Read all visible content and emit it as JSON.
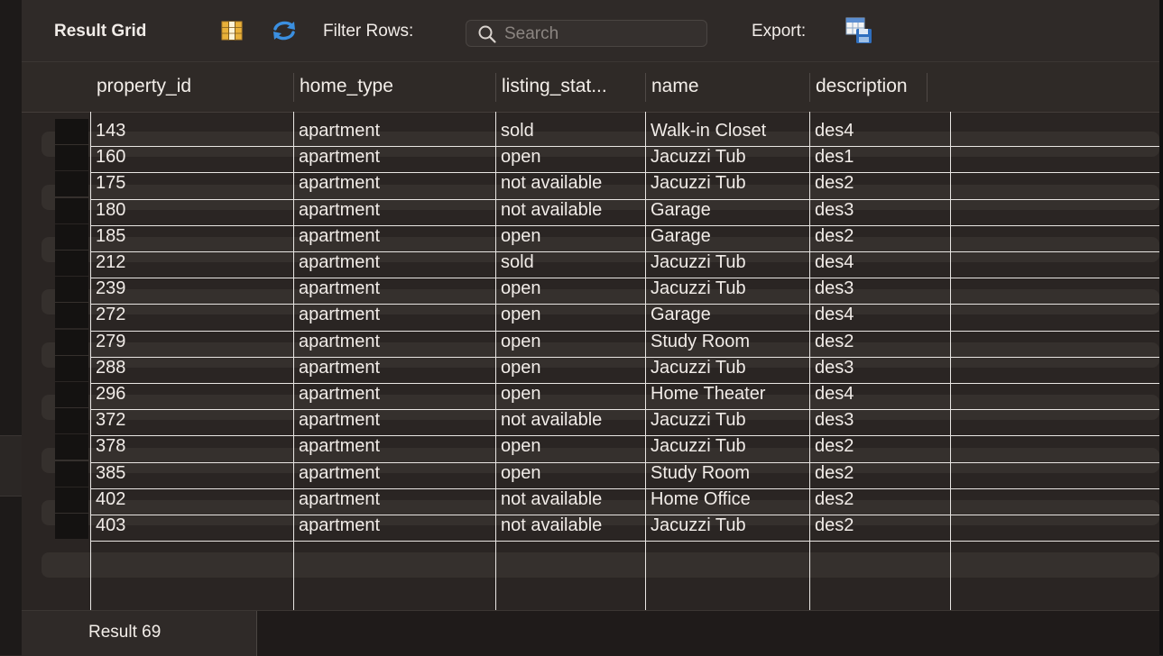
{
  "toolbar": {
    "result_grid_label": "Result Grid",
    "filter_rows_label": "Filter Rows:",
    "search_placeholder": "Search",
    "export_label": "Export:",
    "icons": [
      "grid-layout-icon",
      "refresh-icon",
      "search-icon",
      "export-icon"
    ]
  },
  "columns": [
    "property_id",
    "home_type",
    "listing_stat...",
    "name",
    "description"
  ],
  "rows": [
    [
      "143",
      "apartment",
      "sold",
      "Walk-in Closet",
      "des4"
    ],
    [
      "160",
      "apartment",
      "open",
      "Jacuzzi Tub",
      "des1"
    ],
    [
      "175",
      "apartment",
      "not available",
      "Jacuzzi Tub",
      "des2"
    ],
    [
      "180",
      "apartment",
      "not available",
      "Garage",
      "des3"
    ],
    [
      "185",
      "apartment",
      "open",
      "Garage",
      "des2"
    ],
    [
      "212",
      "apartment",
      "sold",
      "Jacuzzi Tub",
      "des4"
    ],
    [
      "239",
      "apartment",
      "open",
      "Jacuzzi Tub",
      "des3"
    ],
    [
      "272",
      "apartment",
      "open",
      "Garage",
      "des4"
    ],
    [
      "279",
      "apartment",
      "open",
      "Study Room",
      "des2"
    ],
    [
      "288",
      "apartment",
      "open",
      "Jacuzzi Tub",
      "des3"
    ],
    [
      "296",
      "apartment",
      "open",
      "Home Theater",
      "des4"
    ],
    [
      "372",
      "apartment",
      "not available",
      "Jacuzzi Tub",
      "des3"
    ],
    [
      "378",
      "apartment",
      "open",
      "Jacuzzi Tub",
      "des2"
    ],
    [
      "385",
      "apartment",
      "open",
      "Study Room",
      "des2"
    ],
    [
      "402",
      "apartment",
      "not available",
      "Home Office",
      "des2"
    ],
    [
      "403",
      "apartment",
      "not available",
      "Jacuzzi Tub",
      "des2"
    ]
  ],
  "footer": {
    "tab_label": "Result 69"
  },
  "colors": {
    "background": "#2a2523",
    "toolbar": "#2f2a28",
    "grid_lines": "#e9e6e3",
    "text": "#f1ece8"
  }
}
